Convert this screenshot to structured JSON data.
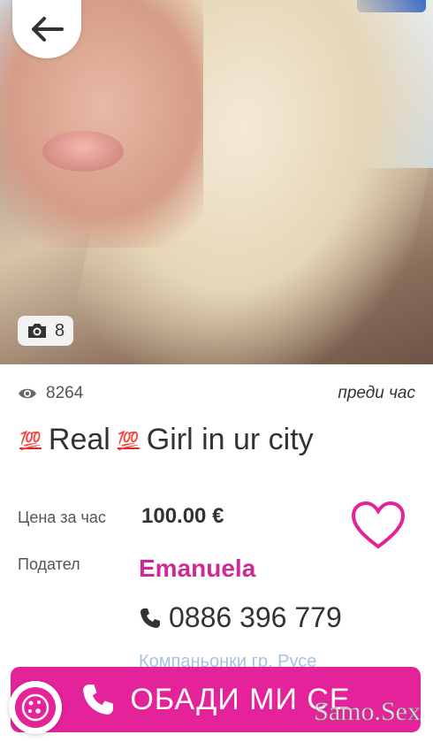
{
  "listing": {
    "photo_count": "8",
    "views": "8264",
    "time_ago": "преди час",
    "title_emoji": "💯",
    "title_part1": "Real",
    "title_part2": "Girl in ur city"
  },
  "details": {
    "price_label": "Цена за час",
    "price_value": "100.00 €",
    "provider_label": "Подател",
    "provider_name": "Emanuela",
    "phone": "0886 396 779",
    "location": "Компаньонки гр. Русе"
  },
  "actions": {
    "call_label": "ОБАДИ МИ СЕ"
  },
  "watermark": "Samo.Sex",
  "colors": {
    "accent": "#e4239a",
    "provider": "#cc2a94",
    "location": "#a7c2e0"
  },
  "icons": [
    "arrow-left-icon",
    "camera-icon",
    "eye-icon",
    "heart-icon",
    "phone-icon",
    "cookie-icon"
  ]
}
